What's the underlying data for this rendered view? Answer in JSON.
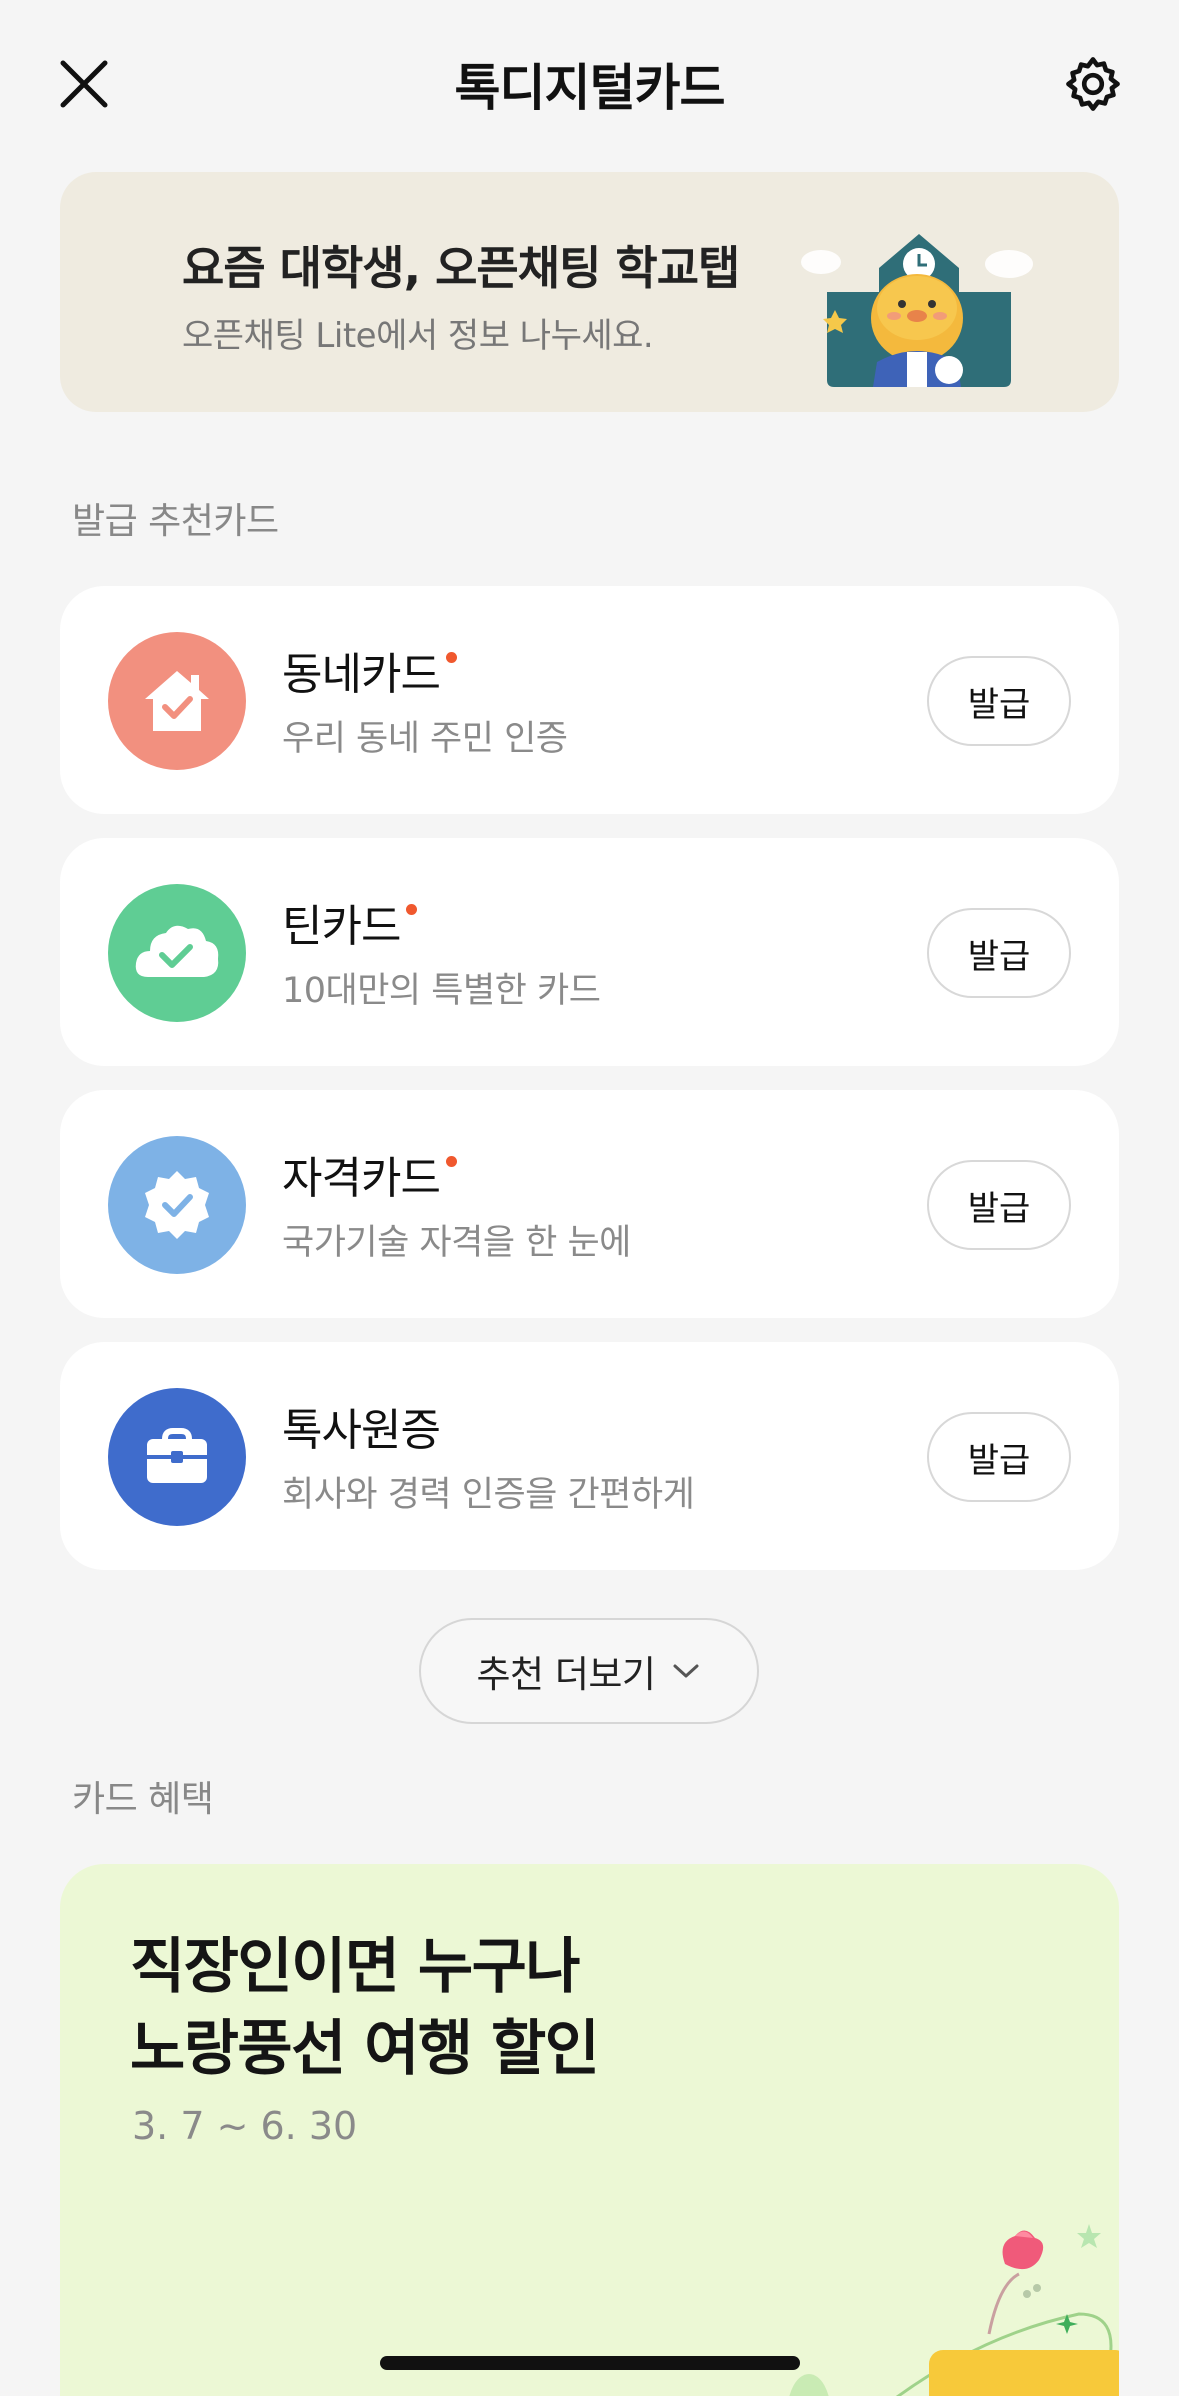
{
  "header": {
    "title": "톡디지털카드"
  },
  "banner": {
    "title": "요즘 대학생, 오픈채팅 학교탭",
    "subtitle": "오픈채팅 Lite에서 정보 나누세요."
  },
  "sections": {
    "recommended_label": "발급 추천카드",
    "benefits_label": "카드 혜택"
  },
  "cards": [
    {
      "name": "동네카드",
      "desc": "우리 동네 주민 인증",
      "button": "발급",
      "new_dot": true,
      "icon": "house-check-icon",
      "color": "#f2907f"
    },
    {
      "name": "틴카드",
      "desc": "10대만의 특별한 카드",
      "button": "발급",
      "new_dot": true,
      "icon": "cloud-check-icon",
      "color": "#5fcd94"
    },
    {
      "name": "자격카드",
      "desc": "국가기술 자격을 한 눈에",
      "button": "발급",
      "new_dot": true,
      "icon": "badge-check-icon",
      "color": "#7eb2e6"
    },
    {
      "name": "톡사원증",
      "desc": "회사와 경력 인증을 간편하게",
      "button": "발급",
      "new_dot": false,
      "icon": "briefcase-icon",
      "color": "#3f6ccc"
    }
  ],
  "more_button": {
    "label": "추천 더보기"
  },
  "benefit": {
    "title_line1": "직장인이면 누구나",
    "title_line2": "노랑풍선 여행 할인",
    "date": "3. 7 ~ 6. 30"
  },
  "colors": {
    "background": "#f5f5f5",
    "banner_bg": "#efebe0",
    "benefit_bg": "#ecf8d5",
    "accent_dot": "#f0582e"
  }
}
